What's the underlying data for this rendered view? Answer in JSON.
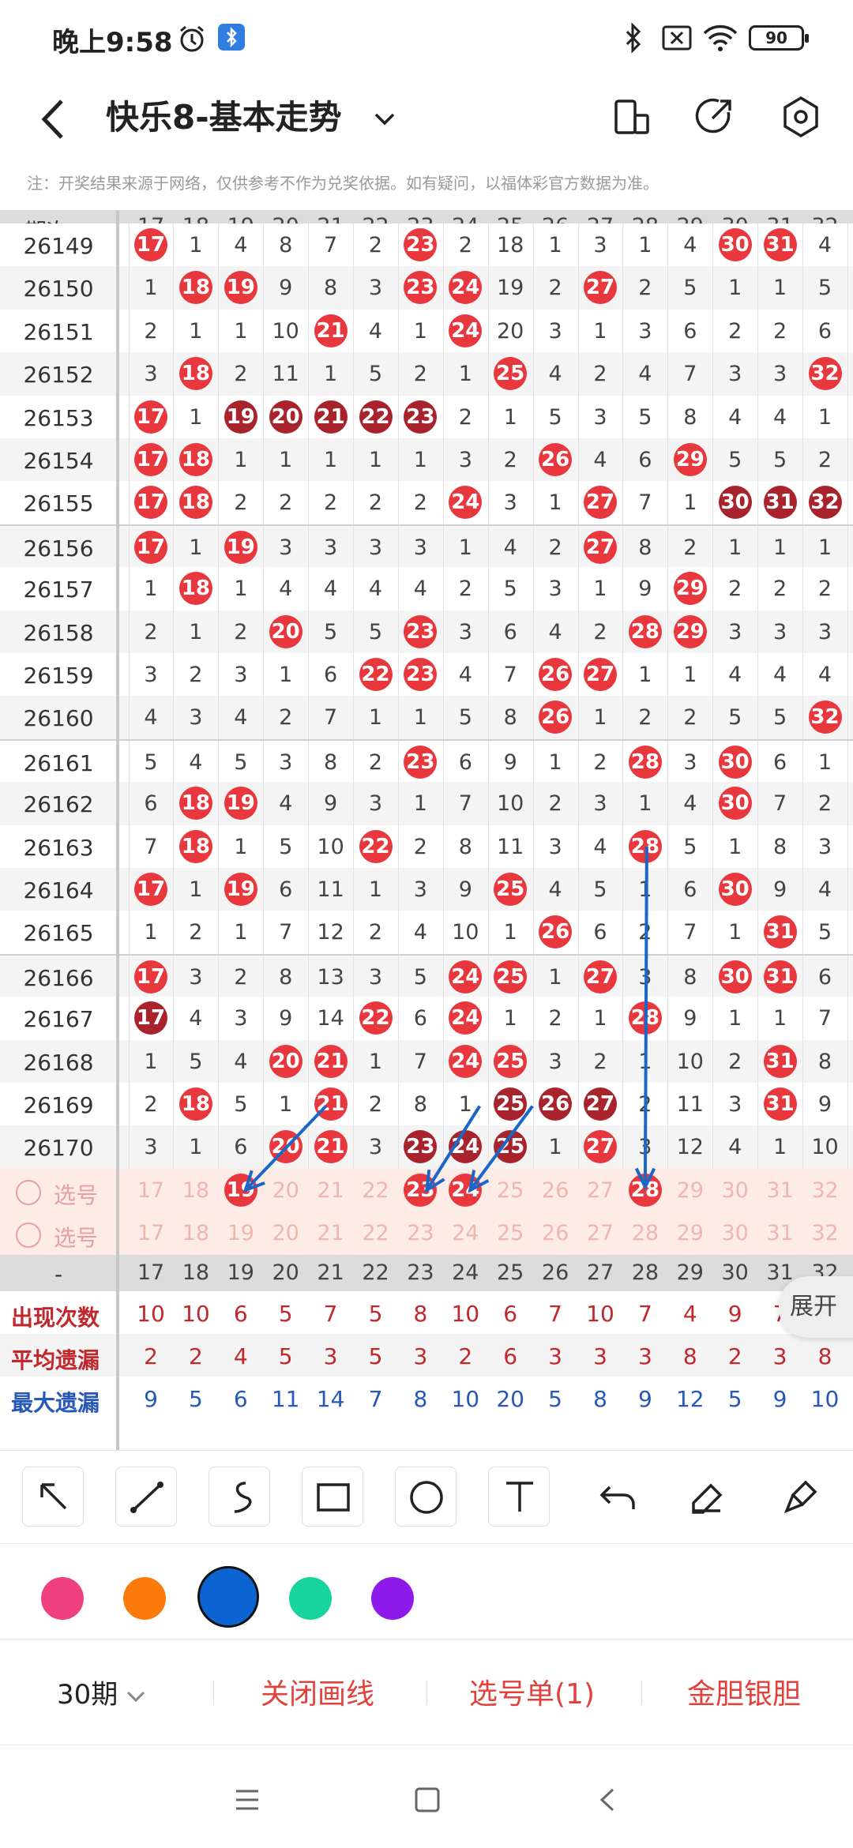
{
  "status_bar": {
    "time": "晚上9:58",
    "battery": "90"
  },
  "header": {
    "title": "快乐8-基本走势"
  },
  "notice": "注：开奖结果来源于网络，仅供参考不作为兑奖依据。如有疑问，以福体彩官方数据为准。",
  "table": {
    "period_header": "期次",
    "columns": [
      "17",
      "18",
      "19",
      "20",
      "21",
      "22",
      "23",
      "24",
      "25",
      "26",
      "27",
      "28",
      "29",
      "30",
      "31",
      "32"
    ],
    "rows": [
      {
        "period": "26149",
        "cells": [
          "17",
          "1",
          "4",
          "8",
          "7",
          "2",
          "23",
          "2",
          "18",
          "1",
          "3",
          "1",
          "4",
          "30",
          "31",
          "4"
        ],
        "hits": [
          0,
          6,
          13,
          14
        ]
      },
      {
        "period": "26150",
        "cells": [
          "1",
          "18",
          "19",
          "9",
          "8",
          "3",
          "23",
          "24",
          "19",
          "2",
          "27",
          "2",
          "5",
          "1",
          "1",
          "5"
        ],
        "hits": [
          1,
          2,
          6,
          7,
          10
        ]
      },
      {
        "period": "26151",
        "cells": [
          "2",
          "1",
          "1",
          "10",
          "21",
          "4",
          "1",
          "24",
          "20",
          "3",
          "1",
          "3",
          "6",
          "2",
          "2",
          "6"
        ],
        "hits": [
          4,
          7
        ]
      },
      {
        "period": "26152",
        "cells": [
          "3",
          "18",
          "2",
          "11",
          "1",
          "5",
          "2",
          "1",
          "25",
          "4",
          "2",
          "4",
          "7",
          "3",
          "3",
          "32"
        ],
        "hits": [
          1,
          8,
          15
        ]
      },
      {
        "period": "26153",
        "cells": [
          "17",
          "1",
          "19",
          "20",
          "21",
          "22",
          "23",
          "2",
          "1",
          "5",
          "3",
          "5",
          "8",
          "4",
          "4",
          "1"
        ],
        "hits": [
          0,
          2,
          3,
          4,
          5,
          6
        ],
        "dark": [
          2,
          3,
          4,
          5,
          6
        ]
      },
      {
        "period": "26154",
        "cells": [
          "17",
          "18",
          "1",
          "1",
          "1",
          "1",
          "1",
          "3",
          "2",
          "26",
          "4",
          "6",
          "29",
          "5",
          "5",
          "2"
        ],
        "hits": [
          0,
          1,
          9,
          12
        ]
      },
      {
        "period": "26155",
        "cells": [
          "17",
          "18",
          "2",
          "2",
          "2",
          "2",
          "2",
          "24",
          "3",
          "1",
          "27",
          "7",
          "1",
          "30",
          "31",
          "32"
        ],
        "hits": [
          0,
          1,
          7,
          10,
          13,
          14,
          15
        ],
        "dark": [
          13,
          14,
          15
        ]
      },
      {
        "period": "26156",
        "cells": [
          "17",
          "1",
          "19",
          "3",
          "3",
          "3",
          "3",
          "1",
          "4",
          "2",
          "27",
          "8",
          "2",
          "1",
          "1",
          "1"
        ],
        "hits": [
          0,
          2,
          10
        ]
      },
      {
        "period": "26157",
        "cells": [
          "1",
          "18",
          "1",
          "4",
          "4",
          "4",
          "4",
          "2",
          "5",
          "3",
          "1",
          "9",
          "29",
          "2",
          "2",
          "2"
        ],
        "hits": [
          1,
          12
        ]
      },
      {
        "period": "26158",
        "cells": [
          "2",
          "1",
          "2",
          "20",
          "5",
          "5",
          "23",
          "3",
          "6",
          "4",
          "2",
          "28",
          "29",
          "3",
          "3",
          "3"
        ],
        "hits": [
          3,
          6,
          11,
          12
        ]
      },
      {
        "period": "26159",
        "cells": [
          "3",
          "2",
          "3",
          "1",
          "6",
          "22",
          "23",
          "4",
          "7",
          "26",
          "27",
          "1",
          "1",
          "4",
          "4",
          "4"
        ],
        "hits": [
          5,
          6,
          9,
          10
        ]
      },
      {
        "period": "26160",
        "cells": [
          "4",
          "3",
          "4",
          "2",
          "7",
          "1",
          "1",
          "5",
          "8",
          "26",
          "1",
          "2",
          "2",
          "5",
          "5",
          "32"
        ],
        "hits": [
          9,
          15
        ]
      },
      {
        "period": "26161",
        "cells": [
          "5",
          "4",
          "5",
          "3",
          "8",
          "2",
          "23",
          "6",
          "9",
          "1",
          "2",
          "28",
          "3",
          "30",
          "6",
          "1"
        ],
        "hits": [
          6,
          11,
          13
        ]
      },
      {
        "period": "26162",
        "cells": [
          "6",
          "18",
          "19",
          "4",
          "9",
          "3",
          "1",
          "7",
          "10",
          "2",
          "3",
          "1",
          "4",
          "30",
          "7",
          "2"
        ],
        "hits": [
          1,
          2,
          13
        ]
      },
      {
        "period": "26163",
        "cells": [
          "7",
          "18",
          "1",
          "5",
          "10",
          "22",
          "2",
          "8",
          "11",
          "3",
          "4",
          "28",
          "5",
          "1",
          "8",
          "3"
        ],
        "hits": [
          1,
          5,
          11
        ]
      },
      {
        "period": "26164",
        "cells": [
          "17",
          "1",
          "19",
          "6",
          "11",
          "1",
          "3",
          "9",
          "25",
          "4",
          "5",
          "1",
          "6",
          "30",
          "9",
          "4"
        ],
        "hits": [
          0,
          2,
          8,
          13
        ]
      },
      {
        "period": "26165",
        "cells": [
          "1",
          "2",
          "1",
          "7",
          "12",
          "2",
          "4",
          "10",
          "1",
          "26",
          "6",
          "2",
          "7",
          "1",
          "31",
          "5"
        ],
        "hits": [
          9,
          14
        ]
      },
      {
        "period": "26166",
        "cells": [
          "17",
          "3",
          "2",
          "8",
          "13",
          "3",
          "5",
          "24",
          "25",
          "1",
          "27",
          "3",
          "8",
          "30",
          "31",
          "6"
        ],
        "hits": [
          0,
          7,
          8,
          10,
          13,
          14
        ]
      },
      {
        "period": "26167",
        "cells": [
          "17",
          "4",
          "3",
          "9",
          "14",
          "22",
          "6",
          "24",
          "1",
          "2",
          "1",
          "28",
          "9",
          "1",
          "1",
          "7"
        ],
        "hits": [
          0,
          5,
          7,
          11
        ],
        "dark": [
          0
        ]
      },
      {
        "period": "26168",
        "cells": [
          "1",
          "5",
          "4",
          "20",
          "21",
          "1",
          "7",
          "24",
          "25",
          "3",
          "2",
          "1",
          "10",
          "2",
          "31",
          "8"
        ],
        "hits": [
          3,
          4,
          7,
          8,
          14
        ]
      },
      {
        "period": "26169",
        "cells": [
          "2",
          "18",
          "5",
          "1",
          "21",
          "2",
          "8",
          "1",
          "25",
          "26",
          "27",
          "2",
          "11",
          "3",
          "31",
          "9"
        ],
        "hits": [
          1,
          4,
          8,
          9,
          10,
          14
        ],
        "dark": [
          8,
          9,
          10
        ]
      },
      {
        "period": "26170",
        "cells": [
          "3",
          "1",
          "6",
          "20",
          "21",
          "3",
          "23",
          "24",
          "25",
          "1",
          "27",
          "3",
          "12",
          "4",
          "1",
          "10"
        ],
        "hits": [
          3,
          4,
          6,
          7,
          8,
          10
        ],
        "dark": [
          6,
          7,
          8
        ]
      }
    ],
    "select_rows": [
      {
        "label": "选号",
        "cells": [
          "17",
          "18",
          "19",
          "20",
          "21",
          "22",
          "23",
          "24",
          "25",
          "26",
          "27",
          "28",
          "29",
          "30",
          "31",
          "32"
        ],
        "picked": [
          2,
          6,
          7,
          11
        ]
      },
      {
        "label": "选号",
        "cells": [
          "17",
          "18",
          "19",
          "20",
          "21",
          "22",
          "23",
          "24",
          "25",
          "26",
          "27",
          "28",
          "29",
          "30",
          "31",
          "32"
        ],
        "picked": []
      }
    ],
    "footer_dash": "-",
    "stats": [
      {
        "label": "出现次数",
        "color": "#c0282d",
        "values": [
          "10",
          "10",
          "6",
          "5",
          "7",
          "5",
          "8",
          "10",
          "6",
          "7",
          "10",
          "7",
          "4",
          "9",
          "7",
          "8"
        ]
      },
      {
        "label": "平均遗漏",
        "color": "#c0282d",
        "values": [
          "2",
          "2",
          "4",
          "5",
          "3",
          "5",
          "3",
          "2",
          "6",
          "3",
          "3",
          "3",
          "8",
          "2",
          "3",
          "8"
        ]
      },
      {
        "label": "最大遗漏",
        "color": "#2758b8",
        "values": [
          "9",
          "5",
          "6",
          "11",
          "14",
          "7",
          "8",
          "10",
          "20",
          "5",
          "8",
          "9",
          "12",
          "5",
          "9",
          "10"
        ]
      }
    ],
    "expand_label": "展开"
  },
  "draw_tools": [
    "arrow-tool-icon",
    "line-tool-icon",
    "curve-tool-icon",
    "rectangle-tool-icon",
    "circle-tool-icon",
    "text-tool-icon",
    "undo-icon",
    "eraser-icon",
    "clear-icon"
  ],
  "palette": [
    "#ef3f7e",
    "#fb7a0c",
    "#0b64d1",
    "#17d49c",
    "#8d1ae8"
  ],
  "bottom_bar": {
    "period_select": "30期",
    "close_lines": "关闭画线",
    "pick_list": "选号单(1)",
    "gold_silver": "金胆银胆"
  },
  "colors": {
    "ball": "#e8373d",
    "ball_dark": "#a8232b",
    "arrow": "#1a67c8"
  }
}
